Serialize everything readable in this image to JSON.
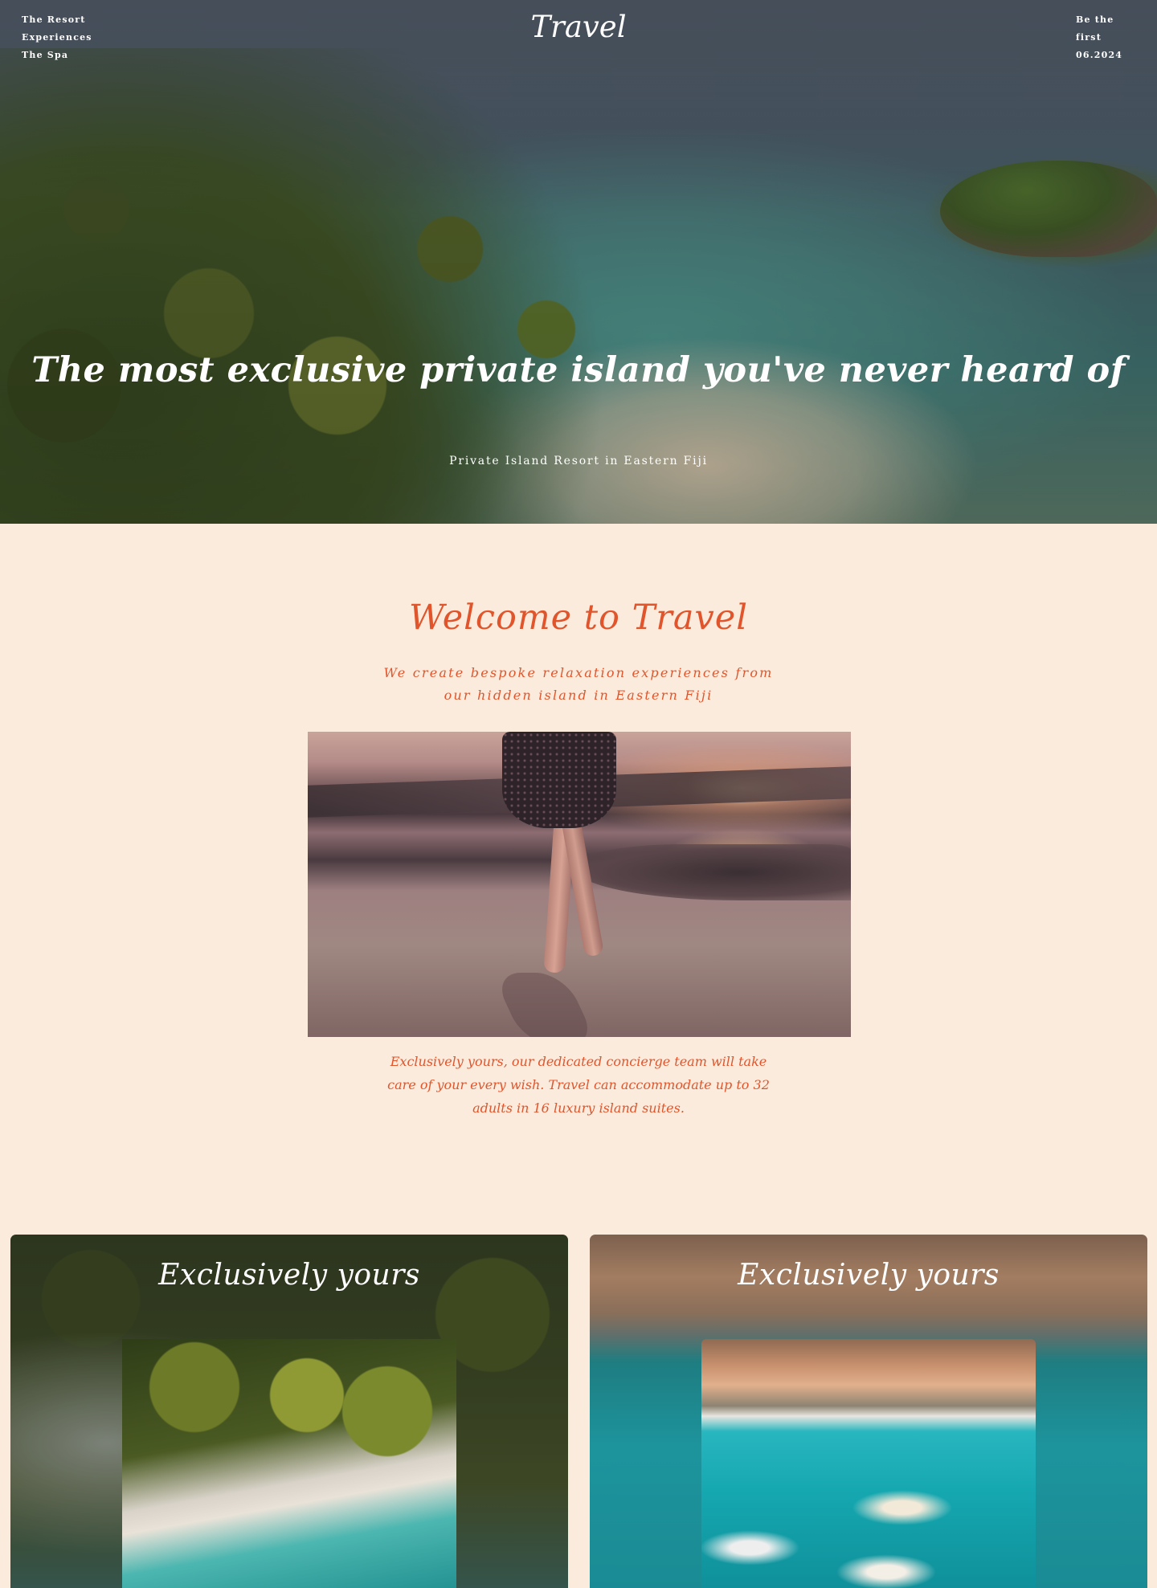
{
  "nav": {
    "links": [
      "The Resort",
      "Experiences",
      "The Spa"
    ],
    "brand": "Travel",
    "promo_line1": "Be the first",
    "promo_line2": "06.2024"
  },
  "hero": {
    "title_pre": "The most ",
    "title_strong": "exclusive",
    "title_post": " private island you've never heard of",
    "subtitle": "Private Island Resort in Eastern Fiji"
  },
  "welcome": {
    "title": "Welcome to Travel",
    "subtitle": "We create bespoke relaxation experiences from our hidden island in Eastern Fiji",
    "body": "Exclusively yours, our dedicated concierge team will take care of your every wish. Travel can accommodate up to 32 adults in 16 luxury island suites."
  },
  "cards": [
    {
      "title": "Exclusively yours"
    },
    {
      "title": "Exclusively yours"
    }
  ]
}
